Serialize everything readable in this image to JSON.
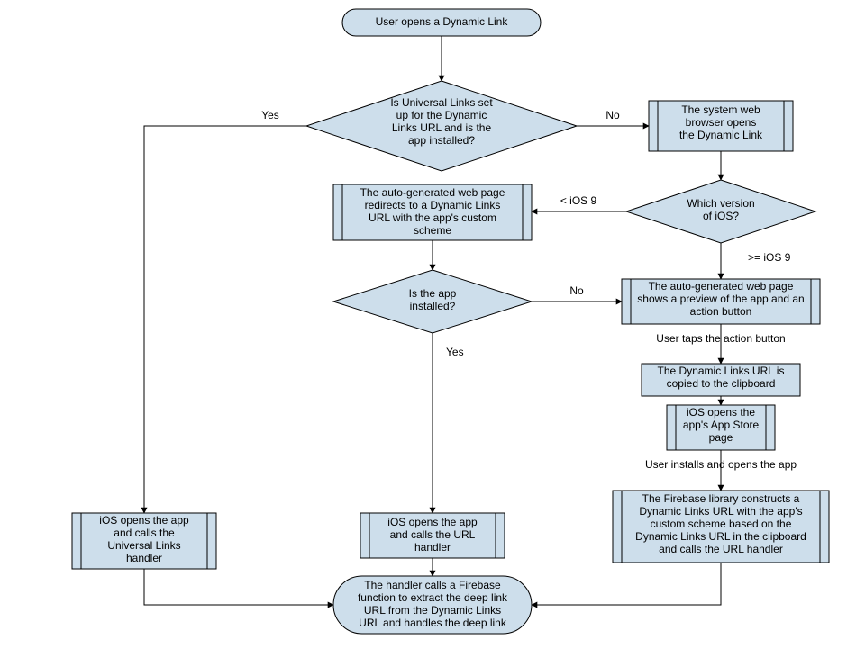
{
  "chart_data": {
    "type": "flowchart",
    "nodes": {
      "start": {
        "shape": "terminator",
        "text": "User opens a Dynamic Link"
      },
      "d_ulinks": {
        "shape": "decision",
        "text": "Is Universal Links set up for the Dynamic Links URL and is the app installed?"
      },
      "p_browser": {
        "shape": "process2",
        "text": "The system web browser opens the Dynamic Link"
      },
      "d_ios": {
        "shape": "decision",
        "text": "Which version of iOS?"
      },
      "p_custom": {
        "shape": "process2",
        "text": "The auto-generated web page redirects to a Dynamic Links URL with the app's custom scheme"
      },
      "d_installed": {
        "shape": "decision",
        "text": "Is the app installed?"
      },
      "p_preview": {
        "shape": "process2",
        "text": "The auto-generated web page shows a preview of the app and an action button"
      },
      "p_clip": {
        "shape": "process",
        "text": "The Dynamic Links URL is copied to the clipboard"
      },
      "p_store": {
        "shape": "process2",
        "text": "iOS opens the app's App Store page"
      },
      "p_firebase": {
        "shape": "process2",
        "text": "The Firebase library constructs a Dynamic Links URL with the app's custom scheme based on the Dynamic Links URL in the clipboard and calls the URL handler"
      },
      "p_ulh": {
        "shape": "process2",
        "text": "iOS opens the app and calls the Universal Links handler"
      },
      "p_urlh": {
        "shape": "process2",
        "text": "iOS opens the app and calls the URL handler"
      },
      "end": {
        "shape": "terminator",
        "text": "The handler calls a Firebase function to extract the deep link URL from the Dynamic Links URL and handles the deep link"
      }
    },
    "edges": [
      {
        "from": "start",
        "to": "d_ulinks"
      },
      {
        "from": "d_ulinks",
        "to": "p_ulh",
        "label": "Yes"
      },
      {
        "from": "d_ulinks",
        "to": "p_browser",
        "label": "No"
      },
      {
        "from": "p_browser",
        "to": "d_ios"
      },
      {
        "from": "d_ios",
        "to": "p_custom",
        "label": "< iOS 9"
      },
      {
        "from": "d_ios",
        "to": "p_preview",
        "label": ">= iOS 9"
      },
      {
        "from": "p_custom",
        "to": "d_installed"
      },
      {
        "from": "d_installed",
        "to": "p_preview",
        "label": "No"
      },
      {
        "from": "d_installed",
        "to": "p_urlh",
        "label": "Yes"
      },
      {
        "from": "p_preview",
        "to": "p_clip",
        "label": "User taps the action button"
      },
      {
        "from": "p_clip",
        "to": "p_store"
      },
      {
        "from": "p_store",
        "to": "p_firebase",
        "label": "User installs and opens the app"
      },
      {
        "from": "p_ulh",
        "to": "end"
      },
      {
        "from": "p_urlh",
        "to": "end"
      },
      {
        "from": "p_firebase",
        "to": "end"
      }
    ]
  },
  "labels": {
    "yes": "Yes",
    "no": "No",
    "lt9": "< iOS 9",
    "ge9": ">= iOS 9",
    "tap": "User taps the action button",
    "install": "User installs and opens the app"
  },
  "lines": {
    "start": [
      "User opens a Dynamic Link"
    ],
    "d_ulinks": [
      "Is Universal Links set",
      "up for the Dynamic",
      "Links URL and is the",
      "app installed?"
    ],
    "p_browser": [
      "The system web",
      "browser opens",
      "the Dynamic Link"
    ],
    "d_ios": [
      "Which version",
      "of iOS?"
    ],
    "p_custom": [
      "The auto-generated web page",
      "redirects to a Dynamic Links",
      "URL with the app's custom",
      "scheme"
    ],
    "d_installed": [
      "Is the app",
      "installed?"
    ],
    "p_preview": [
      "The auto-generated web page",
      "shows a preview of the app and an",
      "action button"
    ],
    "p_clip": [
      "The Dynamic Links URL is",
      "copied to the clipboard"
    ],
    "p_store": [
      "iOS opens the",
      "app's App Store",
      "page"
    ],
    "p_firebase": [
      "The Firebase library constructs a",
      "Dynamic Links URL with the app's",
      "custom scheme based on the",
      "Dynamic Links URL in the clipboard",
      "and calls the URL handler"
    ],
    "p_ulh": [
      "iOS opens the app",
      "and calls the",
      "Universal Links",
      "handler"
    ],
    "p_urlh": [
      "iOS opens the app",
      "and calls the URL",
      "handler"
    ],
    "end": [
      "The handler calls a Firebase",
      "function to extract the deep link",
      "URL from the Dynamic Links",
      "URL and handles the deep link"
    ]
  }
}
